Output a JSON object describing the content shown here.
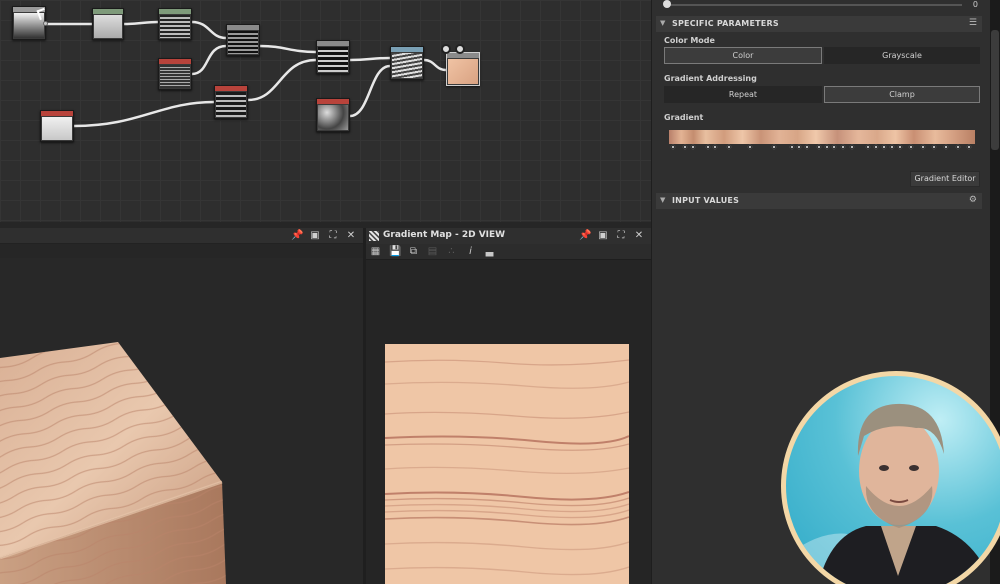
{
  "graph": {
    "nodes": [
      {
        "id": "n1",
        "header": "#9a9a9a",
        "thumb": "linear-gradient(180deg,#f2f2f2,#333)"
      },
      {
        "id": "n2",
        "header": "#7e9a7a",
        "thumb": "linear-gradient(180deg,#ddd,#aaa)"
      },
      {
        "id": "n3",
        "header": "#7e9a7a",
        "thumb": "repeating-linear-gradient(180deg,#222 0 2px,#bbb 2px 4px)"
      },
      {
        "id": "n4",
        "header": "#8a8a8a",
        "thumb": "repeating-linear-gradient(180deg,#111 0 2px,#999 2px 4px)"
      },
      {
        "id": "n5",
        "header": "#b8433b",
        "thumb": "repeating-linear-gradient(180deg,#333 0 2px,#aaa 2px 3px)"
      },
      {
        "id": "n6",
        "header": "#8a8a8a",
        "thumb": "repeating-linear-gradient(180deg,#111 0 3px,#ccc 3px 5px)"
      },
      {
        "id": "n7",
        "header": "#b8433b",
        "thumb": "linear-gradient(180deg,#f0f0f0,#c8c8c8)"
      },
      {
        "id": "n8",
        "header": "#b8433b",
        "thumb": "repeating-linear-gradient(180deg,#1a1a1a 0 3px,#bbb 3px 5px)"
      },
      {
        "id": "n9",
        "header": "#7aa0b5",
        "thumb": "repeating-linear-gradient(170deg,#444 0 2px,#ddd 2px 4px)"
      },
      {
        "id": "n10",
        "header": "#b8433b",
        "thumb": "radial-gradient(circle at 30% 30%,#ddd,#444 60%,#999)"
      },
      {
        "id": "n11",
        "header": "#8a8a8a",
        "thumb": "linear-gradient(135deg,#f0c3a4,#d9a282)"
      }
    ]
  },
  "view3d": {
    "title": "",
    "icons": [
      "pin-icon",
      "restore-icon",
      "maximize-icon",
      "close-icon"
    ]
  },
  "view2d": {
    "title": "Gradient Map - 2D VIEW",
    "icons": [
      "pin-icon",
      "restore-icon",
      "maximize-icon",
      "close-icon"
    ],
    "toolbar": [
      "fit-view-icon",
      "save-icon",
      "copy-icon",
      "channels-icon",
      "tiling-icon",
      "info-icon",
      "histogram-icon"
    ]
  },
  "properties": {
    "slider_value": "0",
    "specific_parameters": "SPECIFIC PARAMETERS",
    "color_mode_label": "Color Mode",
    "color_mode_options": [
      "Color",
      "Grayscale"
    ],
    "color_mode_selected": "Color",
    "gradient_addressing_label": "Gradient Addressing",
    "gradient_addressing_options": [
      "Repeat",
      "Clamp"
    ],
    "gradient_addressing_selected": "Clamp",
    "gradient_label": "Gradient",
    "gradient_editor_button": "Gradient Editor",
    "input_values": "INPUT VALUES"
  },
  "colors": {
    "accent": "#f3d7a6",
    "wood_light": "#eec6a8",
    "wood_dark": "#c48d6f"
  }
}
